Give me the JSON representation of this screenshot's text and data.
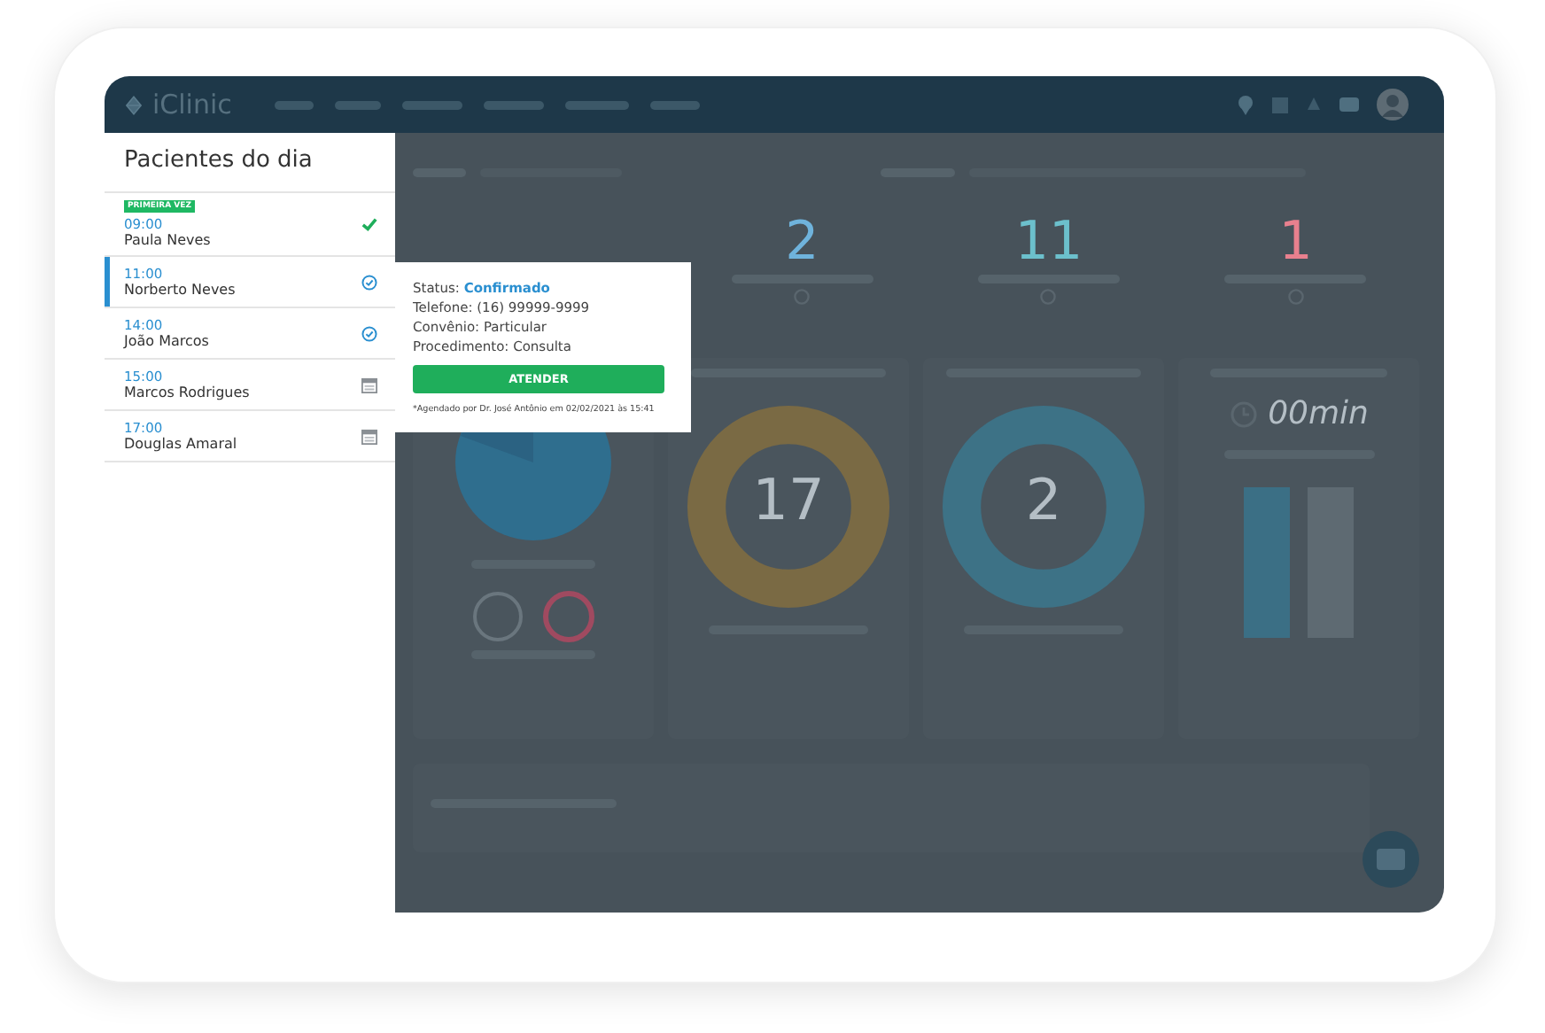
{
  "app": {
    "logo": "iClinic"
  },
  "sidebar": {
    "title": "Pacientes do dia",
    "patients": [
      {
        "badge": "PRIMEIRA VEZ",
        "time": "09:00",
        "name": "Paula Neves",
        "kind": "done",
        "selected": false
      },
      {
        "time": "11:00",
        "name": "Norberto Neves",
        "kind": "confirmed",
        "selected": true
      },
      {
        "time": "14:00",
        "name": "João Marcos",
        "kind": "confirmed",
        "selected": false
      },
      {
        "time": "15:00",
        "name": "Marcos Rodrigues",
        "kind": "scheduled",
        "selected": false
      },
      {
        "time": "17:00",
        "name": "Douglas Amaral",
        "kind": "scheduled",
        "selected": false
      }
    ]
  },
  "popover": {
    "status_label": "Status:",
    "status": "Confirmado",
    "lines": [
      "Telefone: (16) 99999-9999",
      "Convênio: Particular",
      "Procedimento: Consulta"
    ],
    "button": "ATENDER",
    "note": "*Agendado por Dr. José Antônio em 02/02/2021 às 15:41"
  },
  "dashboard": {
    "stats": [
      {
        "value": "2",
        "color": "#6fb3dc"
      },
      {
        "value": "11",
        "color": "#6cc0cc"
      },
      {
        "value": "1",
        "color": "#e8808e"
      }
    ],
    "donuts": [
      {
        "value": "17",
        "color": "#7a6a44"
      },
      {
        "value": "2",
        "color": "#3d7286"
      }
    ],
    "duration": "00min"
  }
}
